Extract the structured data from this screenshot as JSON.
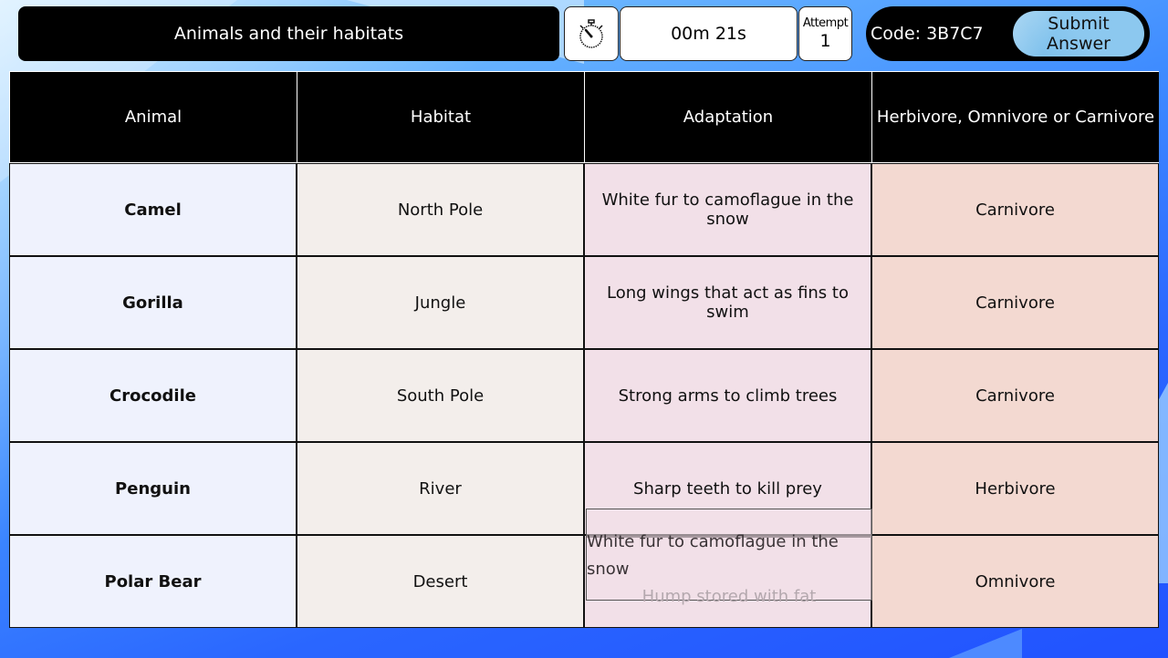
{
  "header": {
    "title": "Animals and their habitats",
    "timer_icon": "stopwatch-icon",
    "timer": "00m 21s",
    "attempt_label": "Attempt",
    "attempt_number": "1",
    "code": "Code: 3B7C7",
    "submit_line1": "Submit",
    "submit_line2": "Answer"
  },
  "table": {
    "columns": [
      "Animal",
      "Habitat",
      "Adaptation",
      "Herbivore, Omnivore or Carnivore"
    ],
    "rows": [
      {
        "animal": "Camel",
        "habitat": "North Pole",
        "adaptation": "White fur to camoflague in the snow",
        "diet": "Carnivore"
      },
      {
        "animal": "Gorilla",
        "habitat": "Jungle",
        "adaptation": "Long wings that act as fins to swim",
        "diet": "Carnivore"
      },
      {
        "animal": "Crocodile",
        "habitat": "South Pole",
        "adaptation": "Strong arms to climb trees",
        "diet": "Carnivore"
      },
      {
        "animal": "Penguin",
        "habitat": "River",
        "adaptation": "Sharp teeth to kill prey",
        "diet": "Herbivore"
      },
      {
        "animal": "Polar Bear",
        "habitat": "Desert",
        "adaptation": "",
        "diet": "Omnivore"
      }
    ]
  },
  "dropdown": {
    "options": [
      "White fur to camoflague in the snow",
      "Hump stored with fat"
    ]
  },
  "colors": {
    "animal_col": "#eff2fd",
    "habitat_col": "#f3eeeb",
    "adaptation_col": "#f2e0e8",
    "diet_col": "#f3d9d1",
    "submit_button": "#8cc8ef"
  }
}
